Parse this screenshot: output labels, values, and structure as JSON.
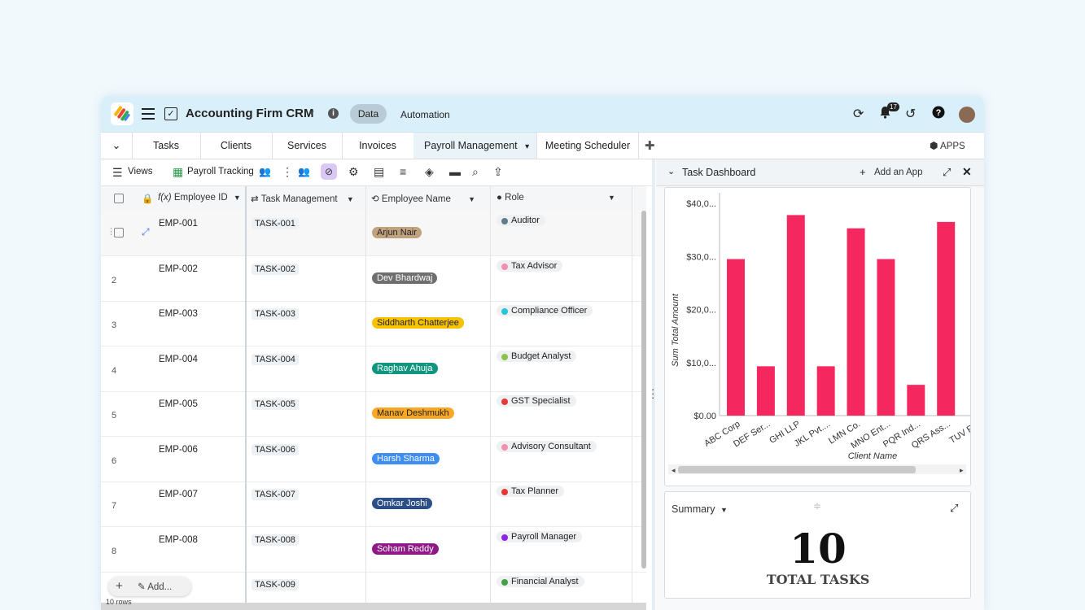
{
  "app": {
    "title": "Accounting Firm CRM",
    "data_label": "Data",
    "automation_label": "Automation",
    "notif_count": "17"
  },
  "tabs": [
    "Tasks",
    "Clients",
    "Services",
    "Invoices",
    "Payroll Management",
    "Meeting Scheduler"
  ],
  "apps_label": "APPS",
  "toolbar": {
    "views": "Views",
    "view_name": "Payroll Tracking"
  },
  "columns": {
    "employee_id": "Employee ID",
    "task": "Task Management",
    "employee_name": "Employee Name",
    "role": "Role"
  },
  "rows": [
    {
      "num": "",
      "id": "EMP-001",
      "task": "TASK-001",
      "name": "Arjun Nair",
      "name_color": "#c1a27e",
      "role": "Auditor",
      "role_color": "#607d8b"
    },
    {
      "num": "2",
      "id": "EMP-002",
      "task": "TASK-002",
      "name": "Dev Bhardwaj",
      "name_color": "#6f6f6f",
      "role": "Tax Advisor",
      "role_color": "#f48fb1"
    },
    {
      "num": "3",
      "id": "EMP-003",
      "task": "TASK-003",
      "name": "Siddharth Chatterjee",
      "name_color": "#f7c200",
      "role": "Compliance Officer",
      "role_color": "#26c6da"
    },
    {
      "num": "4",
      "id": "EMP-004",
      "task": "TASK-004",
      "name": "Raghav Ahuja",
      "name_color": "#12957f",
      "role": "Budget Analyst",
      "role_color": "#8bc34a"
    },
    {
      "num": "5",
      "id": "EMP-005",
      "task": "TASK-005",
      "name": "Manav Deshmukh",
      "name_color": "#f9a825",
      "role": "GST Specialist",
      "role_color": "#e53935"
    },
    {
      "num": "6",
      "id": "EMP-006",
      "task": "TASK-006",
      "name": "Harsh Sharma",
      "name_color": "#3d8ef0",
      "role": "Advisory Consultant",
      "role_color": "#f48fb1"
    },
    {
      "num": "7",
      "id": "EMP-007",
      "task": "TASK-007",
      "name": "Omkar Joshi",
      "name_color": "#2b4f86",
      "role": "Tax Planner",
      "role_color": "#e53935"
    },
    {
      "num": "8",
      "id": "EMP-008",
      "task": "TASK-008",
      "name": "Soham Reddy",
      "name_color": "#8e1a86",
      "role": "Payroll Manager",
      "role_color": "#8e24e6"
    },
    {
      "num": "",
      "id": "",
      "task": "TASK-009",
      "name": "",
      "name_color": "#ffffff",
      "role": "Financial Analyst",
      "role_color": "#43a047"
    }
  ],
  "add_label": "Add...",
  "row_count": "10 rows",
  "panel": {
    "title": "Task Dashboard",
    "add_app": "Add an App"
  },
  "chart_data": {
    "type": "bar",
    "categories": [
      "ABC Corp",
      "DEF Ser...",
      "GHI LLP",
      "JKL Pvt....",
      "LMN Co.",
      "MNO Ent...",
      "PQR Ind...",
      "QRS Ass...",
      "TUV Par"
    ],
    "values": [
      29500,
      9300,
      37800,
      9300,
      35300,
      29500,
      5800,
      36500,
      0
    ],
    "xlabel": "Client Name",
    "ylabel": "Sum Total Amount",
    "ylim": [
      0,
      42000
    ],
    "ytick_labels": [
      "$0.00",
      "$10,0...",
      "$20,0...",
      "$30,0...",
      "$40,0..."
    ],
    "ytick_values": [
      0,
      10000,
      20000,
      30000,
      40000
    ],
    "bar_color": "#f4285e"
  },
  "summary": {
    "label": "Summary",
    "value": "10",
    "caption": "TOTAL TASKS"
  }
}
